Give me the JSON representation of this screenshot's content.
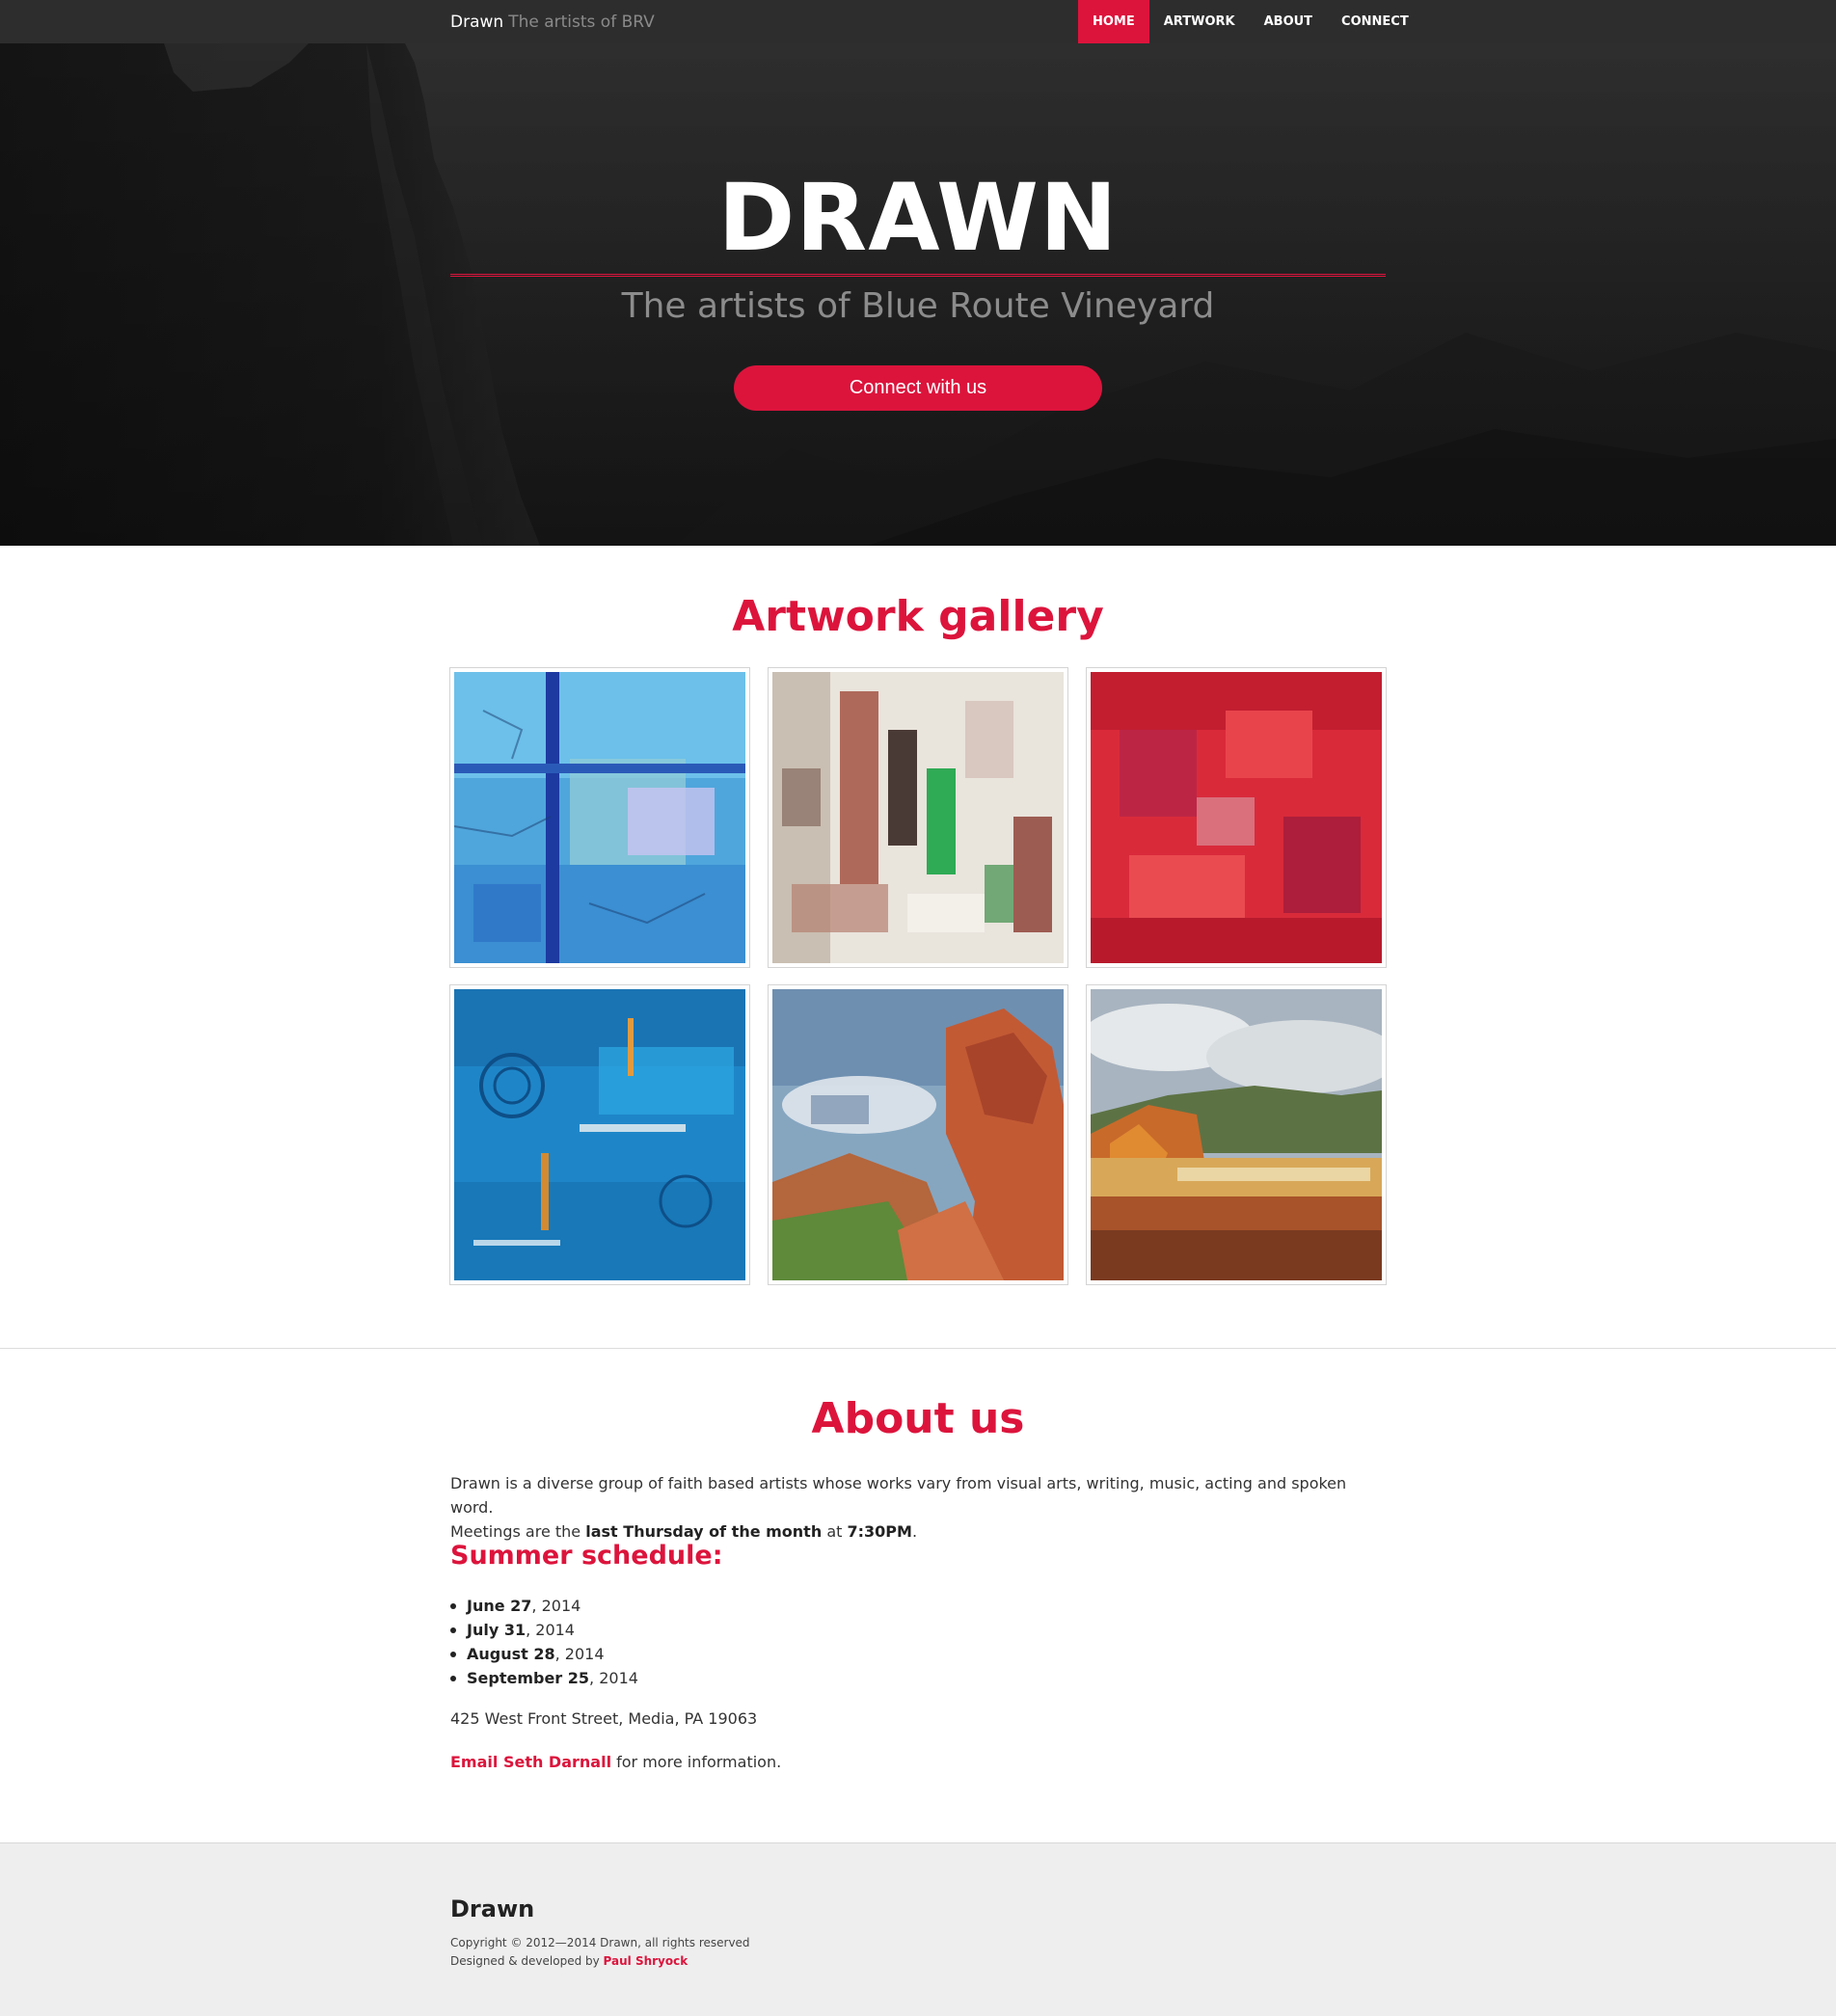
{
  "colors": {
    "accent": "#dc143c",
    "nav_bg": "#2d2d2d",
    "footer_bg": "#eeeeee"
  },
  "nav": {
    "brand": "Drawn",
    "brand_sub": "The artists of BRV",
    "links": [
      {
        "label": "HOME",
        "active": true
      },
      {
        "label": "ARTWORK",
        "active": false
      },
      {
        "label": "ABOUT",
        "active": false
      },
      {
        "label": "CONNECT",
        "active": false
      }
    ]
  },
  "hero": {
    "title": "DRAWN",
    "subtitle": "The artists of Blue Route Vineyard",
    "button": "Connect with us"
  },
  "gallery": {
    "title": "Artwork gallery",
    "items": [
      {
        "subject": "blue abstract painting"
      },
      {
        "subject": "white green and red abstract painting"
      },
      {
        "subject": "red abstract painting"
      },
      {
        "subject": "blue swirl abstract painting"
      },
      {
        "subject": "red rock landscape painting"
      },
      {
        "subject": "autumn field landscape painting"
      }
    ]
  },
  "about": {
    "title": "About us",
    "description": "Drawn is a diverse group of faith based artists whose works vary from visual arts, writing, music, acting and spoken word.",
    "meetings_prefix": "Meetings are the",
    "meetings_when": "last Thursday of the month",
    "meetings_at": "at",
    "meetings_time": "7:30PM",
    "meetings_end": ".",
    "schedule_title": "Summer schedule:",
    "schedule": [
      {
        "date": "June 27",
        "year": ", 2014"
      },
      {
        "date": "July 31",
        "year": ", 2014"
      },
      {
        "date": "August 28",
        "year": ", 2014"
      },
      {
        "date": "September 25",
        "year": ", 2014"
      }
    ],
    "address": "425 West Front Street, Media, PA 19063",
    "email_link": "Email Seth Darnall",
    "email_suffix": " for more information."
  },
  "footer": {
    "brand": "Drawn",
    "copyright": "Copyright © 2012—2014 Drawn, all rights reserved",
    "designed_prefix": "Designed & developed by ",
    "designer": "Paul Shryock"
  }
}
